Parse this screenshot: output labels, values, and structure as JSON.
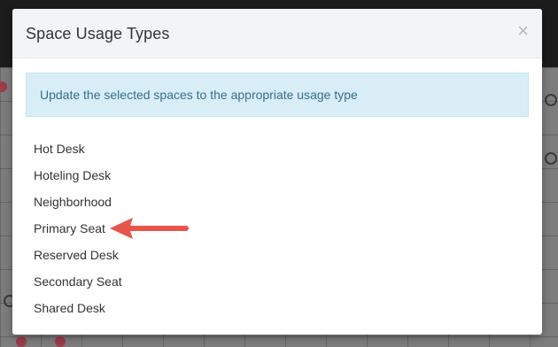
{
  "modal": {
    "title": "Space Usage Types",
    "close_glyph": "×",
    "info_message": "Update the selected spaces to the appropriate usage type",
    "usage_types": [
      "Hot Desk",
      "Hoteling Desk",
      "Neighborhood",
      "Primary Seat",
      "Reserved Desk",
      "Secondary Seat",
      "Shared Desk"
    ]
  },
  "annotation": {
    "pointer_target": "Primary Seat",
    "arrow_color": "#e8544a"
  },
  "colors": {
    "info_background": "#d9edf7",
    "info_text": "#31708f",
    "header_background": "#f2f5f7"
  }
}
